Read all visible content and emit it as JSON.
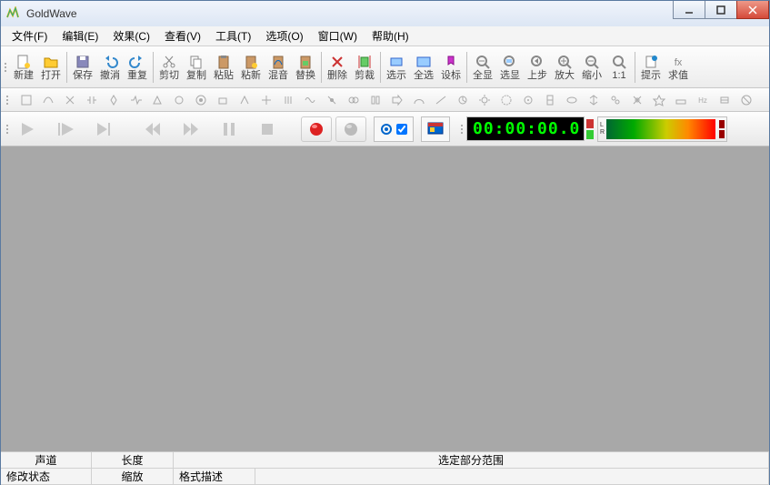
{
  "title": "GoldWave",
  "menu": [
    "文件(F)",
    "编辑(E)",
    "效果(C)",
    "查看(V)",
    "工具(T)",
    "选项(O)",
    "窗口(W)",
    "帮助(H)"
  ],
  "toolbar": [
    "新建",
    "打开",
    "保存",
    "撤消",
    "重复",
    "剪切",
    "复制",
    "粘贴",
    "粘新",
    "混音",
    "替换",
    "删除",
    "剪裁",
    "选示",
    "全选",
    "设标",
    "全显",
    "选显",
    "上步",
    "放大",
    "缩小",
    "1:1",
    "提示",
    "求值"
  ],
  "timer": "00:00:00.0",
  "vu_labels": {
    "l": "L",
    "r": "R"
  },
  "status": {
    "channel_label": "声道",
    "length_label": "长度",
    "selection_label": "选定部分范围",
    "mod_label": "修改状态",
    "zoom_label": "缩放",
    "format_label": "格式描述"
  }
}
